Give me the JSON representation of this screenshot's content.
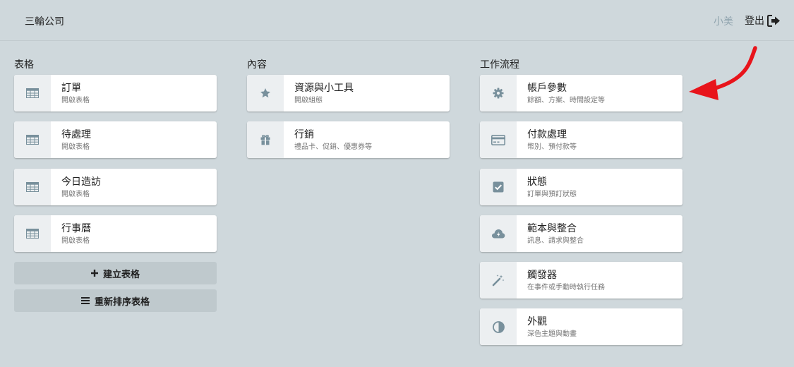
{
  "header": {
    "company": "三輪公司",
    "user": "小美",
    "logout_label": "登出"
  },
  "sections": {
    "tables": {
      "title": "表格",
      "items": [
        {
          "title": "訂單",
          "subtitle": "開啟表格",
          "icon": "table-icon"
        },
        {
          "title": "待處理",
          "subtitle": "開啟表格",
          "icon": "table-icon"
        },
        {
          "title": "今日造訪",
          "subtitle": "開啟表格",
          "icon": "table-icon"
        },
        {
          "title": "行事曆",
          "subtitle": "開啟表格",
          "icon": "table-icon"
        }
      ],
      "actions": {
        "create": "建立表格",
        "reorder": "重新排序表格"
      }
    },
    "content": {
      "title": "內容",
      "items": [
        {
          "title": "資源與小工具",
          "subtitle": "開啟組態",
          "icon": "star-icon"
        },
        {
          "title": "行銷",
          "subtitle": "禮品卡、促銷、優惠券等",
          "icon": "gift-icon"
        }
      ]
    },
    "workflow": {
      "title": "工作流程",
      "items": [
        {
          "title": "帳戶參數",
          "subtitle": "餘額、方案、時間設定等",
          "icon": "gear-icon"
        },
        {
          "title": "付款處理",
          "subtitle": "幣別、預付款等",
          "icon": "credit-card-icon"
        },
        {
          "title": "狀態",
          "subtitle": "訂單與預訂狀態",
          "icon": "checkbox-icon"
        },
        {
          "title": "範本與整合",
          "subtitle": "訊息、請求與整合",
          "icon": "cloud-icon"
        },
        {
          "title": "觸發器",
          "subtitle": "在事件或手動時執行任務",
          "icon": "magic-wand-icon"
        },
        {
          "title": "外觀",
          "subtitle": "深色主題與動畫",
          "icon": "contrast-icon"
        }
      ]
    }
  },
  "colors": {
    "background": "#cfd8dc",
    "card": "#ffffff",
    "icon_box": "#eceff1",
    "icon": "#78909c",
    "action_button": "#bfc9cd",
    "annotation_arrow": "#e8141b"
  }
}
